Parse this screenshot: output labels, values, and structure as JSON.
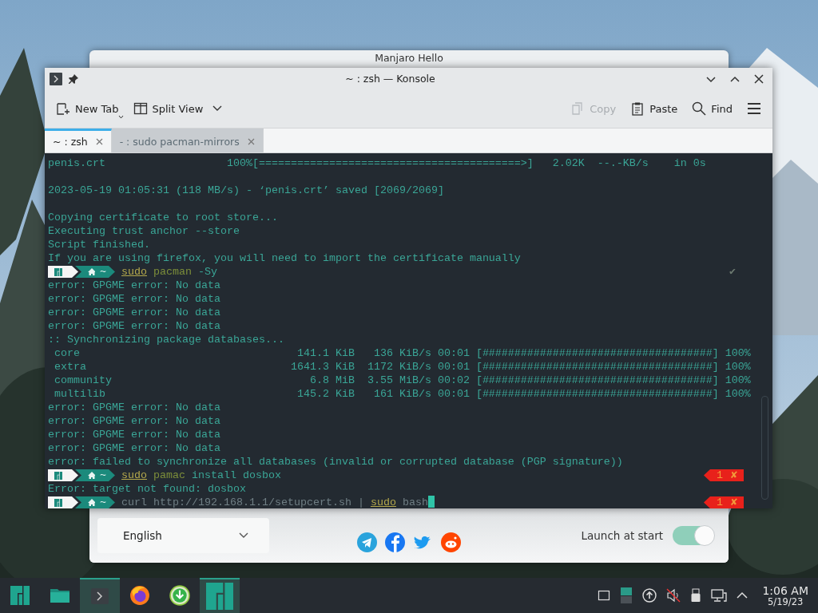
{
  "hello_window": {
    "title": "Manjaro Hello",
    "language": "English",
    "launch_at_start": {
      "label": "Launch at start",
      "on": true
    }
  },
  "konsole": {
    "title": "~ : zsh — Konsole",
    "toolbar_left": [
      {
        "kind": "new-tab",
        "label": "New Tab",
        "disabled": false
      },
      {
        "kind": "split-view",
        "label": "Split View",
        "disabled": false
      }
    ],
    "toolbar_right": [
      {
        "kind": "copy",
        "label": "Copy",
        "disabled": true
      },
      {
        "kind": "paste",
        "label": "Paste",
        "disabled": false
      },
      {
        "kind": "find",
        "label": "Find",
        "disabled": false
      }
    ],
    "tabs": [
      {
        "label": "~ : zsh",
        "selected": true
      },
      {
        "label": "- : sudo pacman-mirrors",
        "selected": false
      }
    ],
    "lines": [
      {
        "kind": "output",
        "text": "penis.crt                   100%[=========================================>]   2.02K  --.-KB/s    in 0s"
      },
      {
        "kind": "blank"
      },
      {
        "kind": "output",
        "text": "2023-05-19 01:05:31 (118 MB/s) - ‘penis.crt’ saved [2069/2069]"
      },
      {
        "kind": "blank"
      },
      {
        "kind": "output",
        "text": "Copying certificate to root store..."
      },
      {
        "kind": "output",
        "text": "Executing trust anchor --store"
      },
      {
        "kind": "output",
        "text": "Script finished."
      },
      {
        "kind": "output",
        "text": "If you are using firefox, you will need to import the certificate manually"
      },
      {
        "kind": "prompt",
        "directory": "~",
        "command": [
          {
            "kind": "sudo",
            "text": "sudo"
          },
          {
            "kind": "program",
            "text": "pacman"
          },
          {
            "kind": "argument",
            "text": "-Sy"
          }
        ],
        "status": {
          "kind": "ok",
          "icon": "✔"
        },
        "cursor": false
      },
      {
        "kind": "output",
        "text": "error: GPGME error: No data"
      },
      {
        "kind": "output",
        "text": "error: GPGME error: No data"
      },
      {
        "kind": "output",
        "text": "error: GPGME error: No data"
      },
      {
        "kind": "output",
        "text": "error: GPGME error: No data"
      },
      {
        "kind": "output",
        "text": ":: Synchronizing package databases..."
      },
      {
        "kind": "output",
        "text": " core                                  141.1 KiB   136 KiB/s 00:01 [####################################] 100%"
      },
      {
        "kind": "output",
        "text": " extra                                1641.3 KiB  1172 KiB/s 00:01 [####################################] 100%"
      },
      {
        "kind": "output",
        "text": " community                               6.8 MiB  3.55 MiB/s 00:02 [####################################] 100%"
      },
      {
        "kind": "output",
        "text": " multilib                              145.2 KiB   161 KiB/s 00:01 [####################################] 100%"
      },
      {
        "kind": "output",
        "text": "error: GPGME error: No data"
      },
      {
        "kind": "output",
        "text": "error: GPGME error: No data"
      },
      {
        "kind": "output",
        "text": "error: GPGME error: No data"
      },
      {
        "kind": "output",
        "text": "error: GPGME error: No data"
      },
      {
        "kind": "output",
        "text": "error: failed to synchronize all databases (invalid or corrupted database (PGP signature))"
      },
      {
        "kind": "prompt",
        "directory": "~",
        "command": [
          {
            "kind": "sudo",
            "text": "sudo"
          },
          {
            "kind": "program",
            "text": "pamac"
          },
          {
            "kind": "argument",
            "text": "install dosbox"
          }
        ],
        "status": {
          "kind": "error",
          "code": "1",
          "icon": "✘"
        },
        "cursor": false
      },
      {
        "kind": "output",
        "text": "Error: target not found: dosbox"
      },
      {
        "kind": "prompt",
        "directory": "~",
        "command": [
          {
            "kind": "plain",
            "text": "curl http://192.168.1.1/setupcert.sh |"
          },
          {
            "kind": "sudo",
            "text": "sudo"
          },
          {
            "kind": "plain",
            "text": "bash"
          }
        ],
        "status": {
          "kind": "error",
          "code": "1",
          "icon": "✘"
        },
        "cursor": true
      }
    ]
  },
  "taskbar": {
    "tasks": [
      {
        "kind": "launcher",
        "selected": false
      },
      {
        "kind": "folder",
        "selected": false
      },
      {
        "kind": "terminal",
        "selected": true
      },
      {
        "kind": "browser",
        "selected": false
      },
      {
        "kind": "download",
        "selected": false
      },
      {
        "kind": "hello",
        "selected": true
      }
    ],
    "clock": {
      "time": "1:06 AM",
      "date": "5/19/23"
    }
  }
}
